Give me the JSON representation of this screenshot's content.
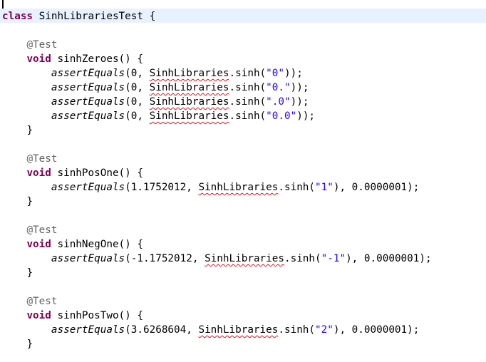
{
  "class_decl": {
    "keyword": "class",
    "name": "SinhLibrariesTest",
    "brace": "{"
  },
  "annotation": "@Test",
  "void_kw": "void",
  "assert_fn": "assertEquals",
  "lib_name": "SinhLibraries",
  "method_call": ".sinh(",
  "close_brace": "}",
  "tests": [
    {
      "name": "sinhZeroes() {",
      "asserts": [
        {
          "prefix": "(0, ",
          "arg": "\"0\"",
          "suffix": "));"
        },
        {
          "prefix": "(0, ",
          "arg": "\"0.\"",
          "suffix": "));"
        },
        {
          "prefix": "(0, ",
          "arg": "\".0\"",
          "suffix": "));"
        },
        {
          "prefix": "(0, ",
          "arg": "\"0.0\"",
          "suffix": "));"
        }
      ]
    },
    {
      "name": "sinhPosOne() {",
      "asserts": [
        {
          "prefix": "(1.1752012, ",
          "arg": "\"1\"",
          "suffix": "), 0.0000001);"
        }
      ]
    },
    {
      "name": "sinhNegOne() {",
      "asserts": [
        {
          "prefix": "(-1.1752012, ",
          "arg": "\"-1\"",
          "suffix": "), 0.0000001);"
        }
      ]
    },
    {
      "name": "sinhPosTwo() {",
      "asserts": [
        {
          "prefix": "(3.6268604, ",
          "arg": "\"2\"",
          "suffix": "), 0.0000001);"
        }
      ]
    }
  ]
}
